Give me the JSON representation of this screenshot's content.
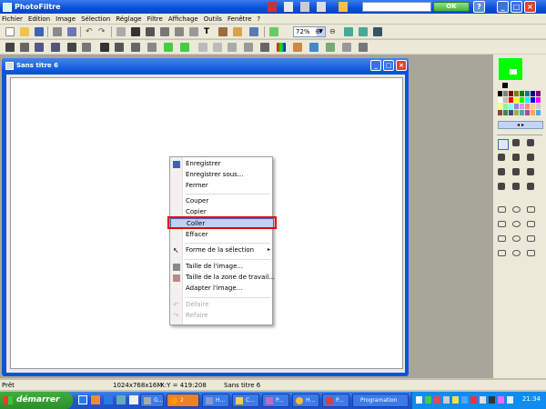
{
  "app": {
    "title": "PhotoFiltre",
    "ok_label": "OK"
  },
  "menubar": [
    "Fichier",
    "Edition",
    "Image",
    "Sélection",
    "Réglage",
    "Filtre",
    "Affichage",
    "Outils",
    "Fenêtre",
    "?"
  ],
  "zoom": {
    "value": "72%"
  },
  "document": {
    "title": "Sans titre 6"
  },
  "context_menu": {
    "items": [
      {
        "label": "Enregistrer",
        "enabled": true
      },
      {
        "label": "Enregistrer sous...",
        "enabled": true
      },
      {
        "label": "Fermer",
        "enabled": true
      },
      {
        "label": "Couper",
        "enabled": true
      },
      {
        "label": "Copier",
        "enabled": true
      },
      {
        "label": "Coller",
        "enabled": true,
        "highlighted": true
      },
      {
        "label": "Effacer",
        "enabled": true
      },
      {
        "label": "Forme de la sélection",
        "enabled": true,
        "submenu": true
      },
      {
        "label": "Taille de l'image...",
        "enabled": true
      },
      {
        "label": "Taille de la zone de travail...",
        "enabled": true
      },
      {
        "label": "Adapter l'image...",
        "enabled": true
      },
      {
        "label": "Défaire",
        "enabled": false
      },
      {
        "label": "Refaire",
        "enabled": false
      }
    ],
    "submenu_arrow": "▸"
  },
  "colors": {
    "foreground": "#00ff00",
    "background": "#ffffff",
    "highlight_outline": "#e00000",
    "accent": "#0a4fd6"
  },
  "statusbar": {
    "state": "Prêt",
    "image_size": "1024x768x16M",
    "coords": "X:Y = 419:208",
    "doc": "Sans titre 6"
  },
  "taskbar": {
    "start_label": "démarrer",
    "tasks": [
      {
        "label": "G..."
      },
      {
        "label": "2"
      },
      {
        "label": "H..."
      },
      {
        "label": "C..."
      },
      {
        "label": "P..."
      },
      {
        "label": "H..."
      },
      {
        "label": "P..."
      },
      {
        "label": "Programation"
      }
    ],
    "clock": "21:34"
  }
}
